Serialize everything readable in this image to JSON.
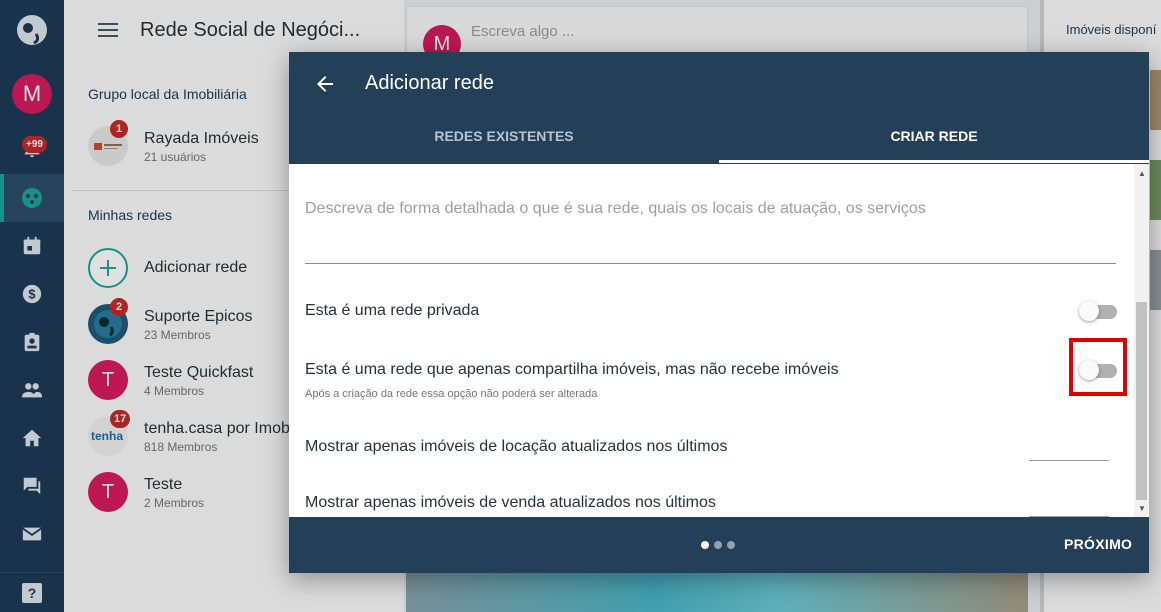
{
  "rail": {
    "avatar_letter": "M",
    "notifications_badge": "+99",
    "help_label": "?"
  },
  "sidebar": {
    "app_title": "Rede Social de Negóci...",
    "local_group_heading": "Grupo local da Imobiliária",
    "local_group": {
      "name": "Rayada Imóveis",
      "sub": "21 usuários",
      "badge": "1"
    },
    "my_networks_heading": "Minhas redes",
    "add_network_label": "Adicionar rede",
    "networks": [
      {
        "name": "Suporte Epicos",
        "sub": "23 Membros",
        "badge": "2"
      },
      {
        "name": "Teste Quickfast",
        "sub": "4 Membros",
        "letter": "T"
      },
      {
        "name": "tenha.casa por Imobz",
        "sub": "818 Membros",
        "badge": "17"
      },
      {
        "name": "Teste",
        "sub": "2 Membros",
        "letter": "T"
      }
    ]
  },
  "feed": {
    "avatar_letter": "M",
    "compose_placeholder": "Escreva algo ..."
  },
  "right_panel": {
    "heading": "Imóveis disponí"
  },
  "modal": {
    "title": "Adicionar rede",
    "tabs": [
      {
        "label": "REDES EXISTENTES",
        "active": false
      },
      {
        "label": "CRIAR REDE",
        "active": true
      }
    ],
    "description_placeholder": "Descreva de forma detalhada o que é sua rede, quais os locais de atuação, os serviços",
    "options": {
      "private_label": "Esta é uma rede privada",
      "private_on": false,
      "share_only_label": "Esta é uma rede que apenas compartilha imóveis, mas não recebe imóveis",
      "share_only_hint": "Após a criação da rede essa opção não poderá ser alterada",
      "share_only_on": false,
      "rent_label": "Mostrar apenas imóveis de locação atualizados nos últimos",
      "sale_label": "Mostrar apenas imóveis de venda atualizados nos últimos"
    },
    "step_current": 1,
    "step_total": 3,
    "next_label": "PRÓXIMO"
  },
  "colors": {
    "rail_bg": "#1d3b57",
    "modal_header": "#234058",
    "accent_teal": "#1aa89a",
    "avatar_pink": "#d81b60",
    "badge_red": "#c62828",
    "highlight_red": "#e00000"
  }
}
